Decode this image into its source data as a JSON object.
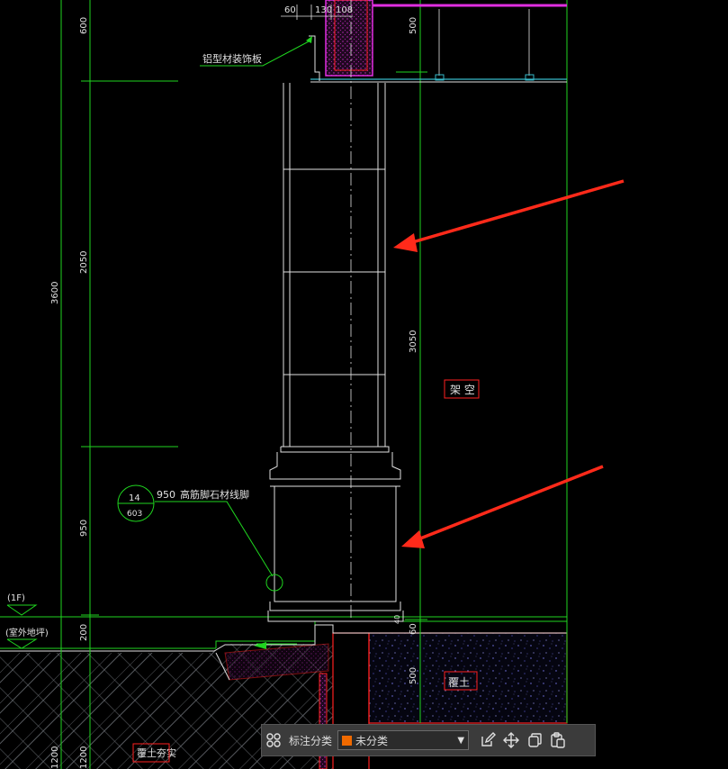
{
  "drawing": {
    "dims": {
      "d_600": "600",
      "d_2050": "2050",
      "d_3600": "3600",
      "d_950": "950",
      "d_200": "200",
      "d_1200a": "1200",
      "d_1200b": "1200",
      "d_60": "60",
      "d_130": "130",
      "d_108": "108",
      "d_500top": "500",
      "d_3050": "3050",
      "d_60b": "60",
      "d_40": "40",
      "d_500bot": "500"
    },
    "labels": {
      "aluminum_panel": "铝型材装饰板",
      "skirting_num": "950",
      "skirting_text": "高筋脚石材线脚",
      "detail_top": "14",
      "detail_bottom": "603",
      "level_1f": "(1F)",
      "level_outdoor": "(室外地坪)",
      "overhead": "架 空",
      "fill_soil": "覆土",
      "compacted_fill": "覆土夯实"
    }
  },
  "toolbar": {
    "label": "标注分类",
    "selected": "未分类",
    "swatch_color": "#f06a00",
    "icons": [
      "grid-icon",
      "edit-icon",
      "move-icon",
      "copy-icon",
      "paste-icon"
    ]
  },
  "colors": {
    "arrow": "#ff2a1a",
    "cad_green": "#1fd41f",
    "cad_white": "#e0e0e0",
    "cad_cyan": "#36b9c9",
    "cad_magenta": "#e02ee0",
    "cad_red": "#ff2020"
  }
}
